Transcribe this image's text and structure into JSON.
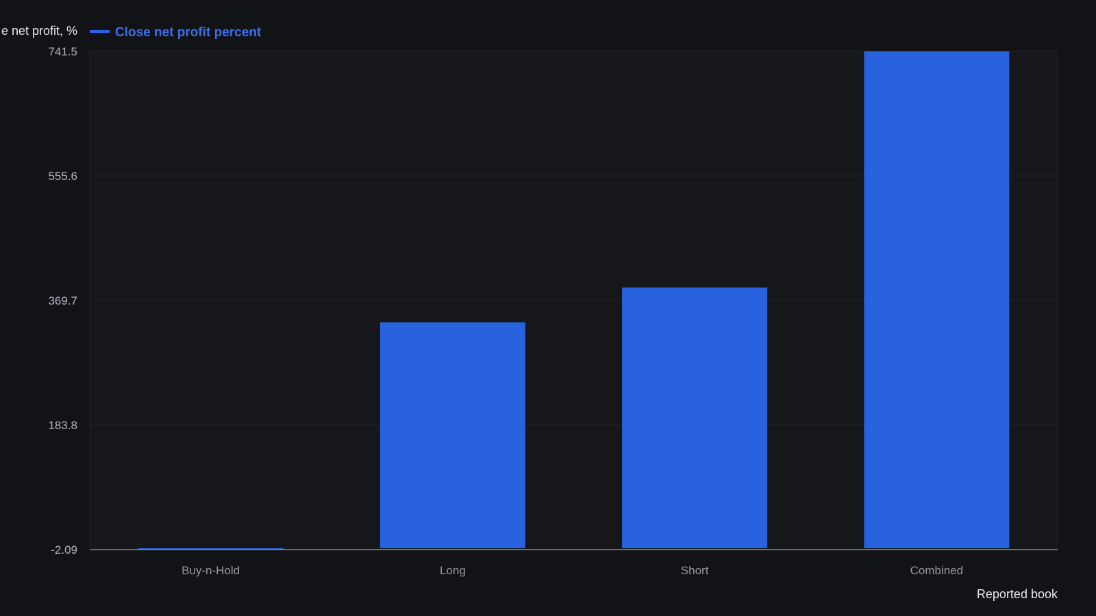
{
  "chart_data": {
    "type": "bar",
    "ylabel": "e net profit, %",
    "categories": [
      "Buy-n-Hold",
      "Long",
      "Short",
      "Combined"
    ],
    "series": [
      {
        "name": "Close net profit percent",
        "values": [
          -2.09,
          337,
          389,
          741.5
        ],
        "color": "#2862de"
      }
    ],
    "ylim": [
      -2.09,
      741.5
    ],
    "yticks": [
      "741.5",
      "555.6",
      "369.7",
      "183.8",
      "-2.09"
    ],
    "grid": true,
    "legend": "top-left"
  },
  "footer": {
    "note": "Reported book"
  },
  "colors": {
    "background": "#121317",
    "plot_background": "#15171b",
    "grid": "#23262c",
    "axis": "#868993",
    "bar": "#2862de"
  }
}
